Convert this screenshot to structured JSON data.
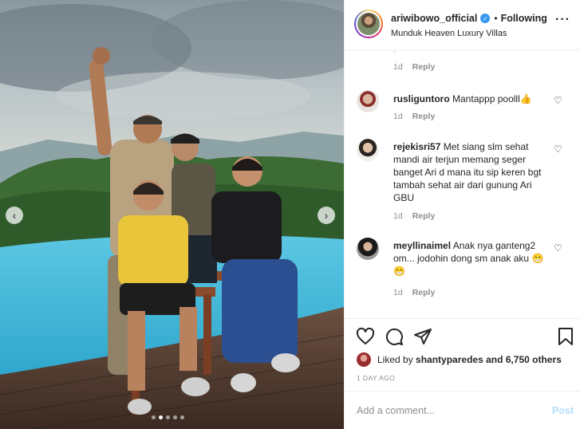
{
  "header": {
    "username": "ariwibowo_official",
    "separator": "•",
    "follow_status": "Following",
    "location": "Munduk Heaven Luxury Villas",
    "more_label": "···"
  },
  "comments": {
    "top_partial_meta": {
      "time": "1d",
      "reply": "Reply"
    },
    "items": [
      {
        "user": "rusliguntoro",
        "text": "Mantappp poolll👍",
        "time": "1d",
        "reply": "Reply"
      },
      {
        "user": "rejekisri57",
        "text": "Met siang slm sehat mandi air terjun memang seger banget Ari d mana itu sip keren bgt tambah sehat air dari gunung Ari GBU",
        "time": "1d",
        "reply": "Reply"
      },
      {
        "user": "meyllinaimel",
        "text": "Anak nya ganteng2 om... jodohin dong sm anak aku 😁😁",
        "time": "1d",
        "reply": "Reply"
      }
    ]
  },
  "likes": {
    "prefix": "Liked by",
    "liker": "shantyparedes",
    "suffix": "and 6,750 others"
  },
  "time_ago": "1 DAY AGO",
  "add_comment": {
    "placeholder": "Add a comment...",
    "post_label": "Post"
  },
  "carousel": {
    "prev_glyph": "‹",
    "next_glyph": "›",
    "dot_count": 5,
    "active_dot": 1
  },
  "colors": {
    "link_blue": "#3897f0",
    "post_disabled": "#b2dffc",
    "muted": "#8e8e8e",
    "pool": "#3fb8d8"
  }
}
